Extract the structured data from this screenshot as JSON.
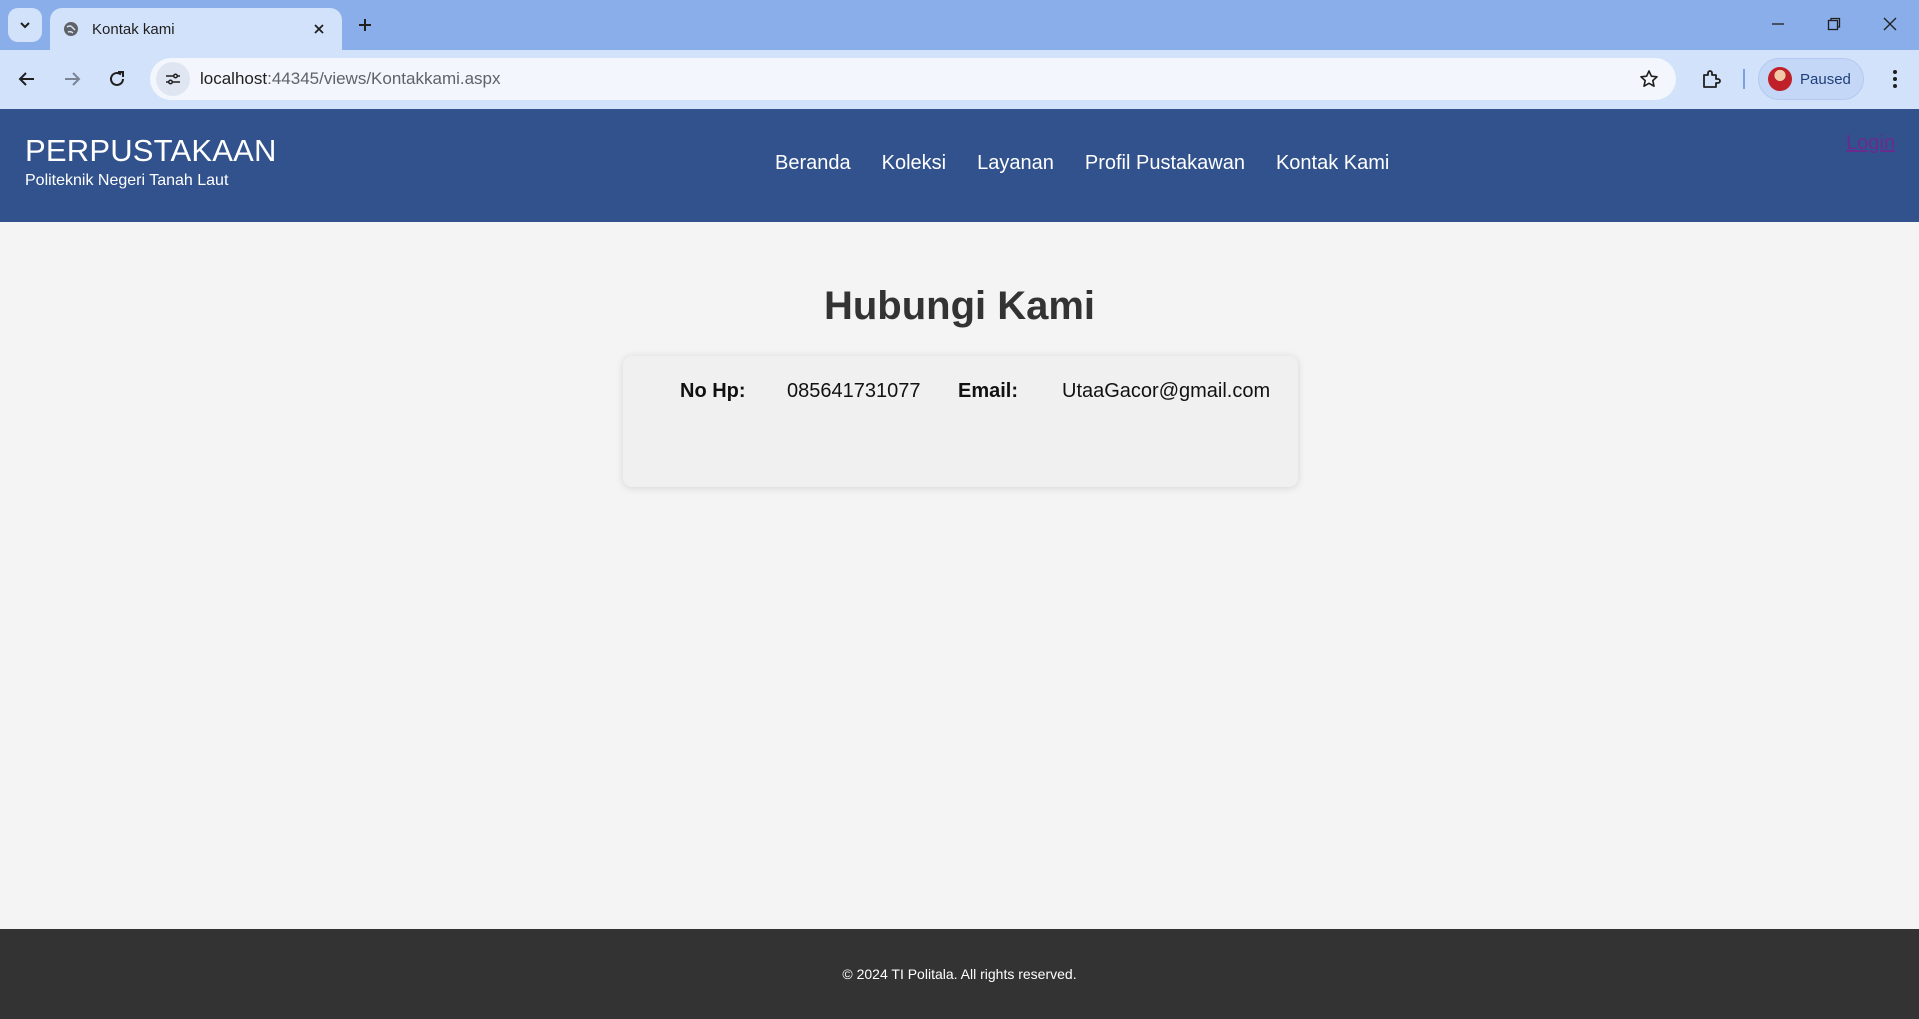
{
  "browser": {
    "tab_title": "Kontak kami",
    "url_host": "localhost",
    "url_path": ":44345/views/Kontakkami.aspx",
    "profile_label": "Paused"
  },
  "header": {
    "brand_title": "PERPUSTAKAAN",
    "brand_subtitle": "Politeknik Negeri Tanah Laut",
    "nav": [
      "Beranda",
      "Koleksi",
      "Layanan",
      "Profil Pustakawan",
      "Kontak Kami"
    ],
    "login_label": "Login"
  },
  "main": {
    "heading": "Hubungi Kami",
    "contact": {
      "phone_label": "No Hp:",
      "phone_value": "085641731077",
      "email_label": "Email:",
      "email_value": "UtaaGacor@gmail.com"
    }
  },
  "footer": {
    "text": "© 2024 TI Politala. All rights reserved."
  },
  "colors": {
    "tabstrip": "#8aaeea",
    "toolbar": "#d3e2fb",
    "header_bg": "#31528c",
    "page_bg": "#f4f4f4",
    "footer_bg": "#333333",
    "login_link": "#6a2b8f"
  }
}
